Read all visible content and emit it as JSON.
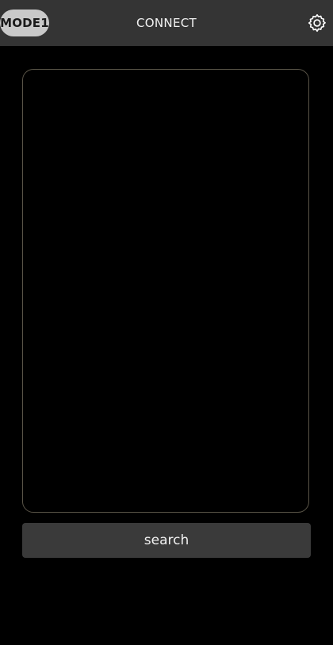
{
  "header": {
    "mode_label": "MODE1",
    "title": "CONNECT",
    "settings_icon": "gear-icon"
  },
  "device_list": {
    "items": []
  },
  "actions": {
    "search_label": "search"
  },
  "colors": {
    "background": "#000000",
    "topbar": "#343434",
    "mode_pill": "#c9c9c9",
    "panel_border": "#5a5548",
    "button": "#3a3a3a"
  }
}
